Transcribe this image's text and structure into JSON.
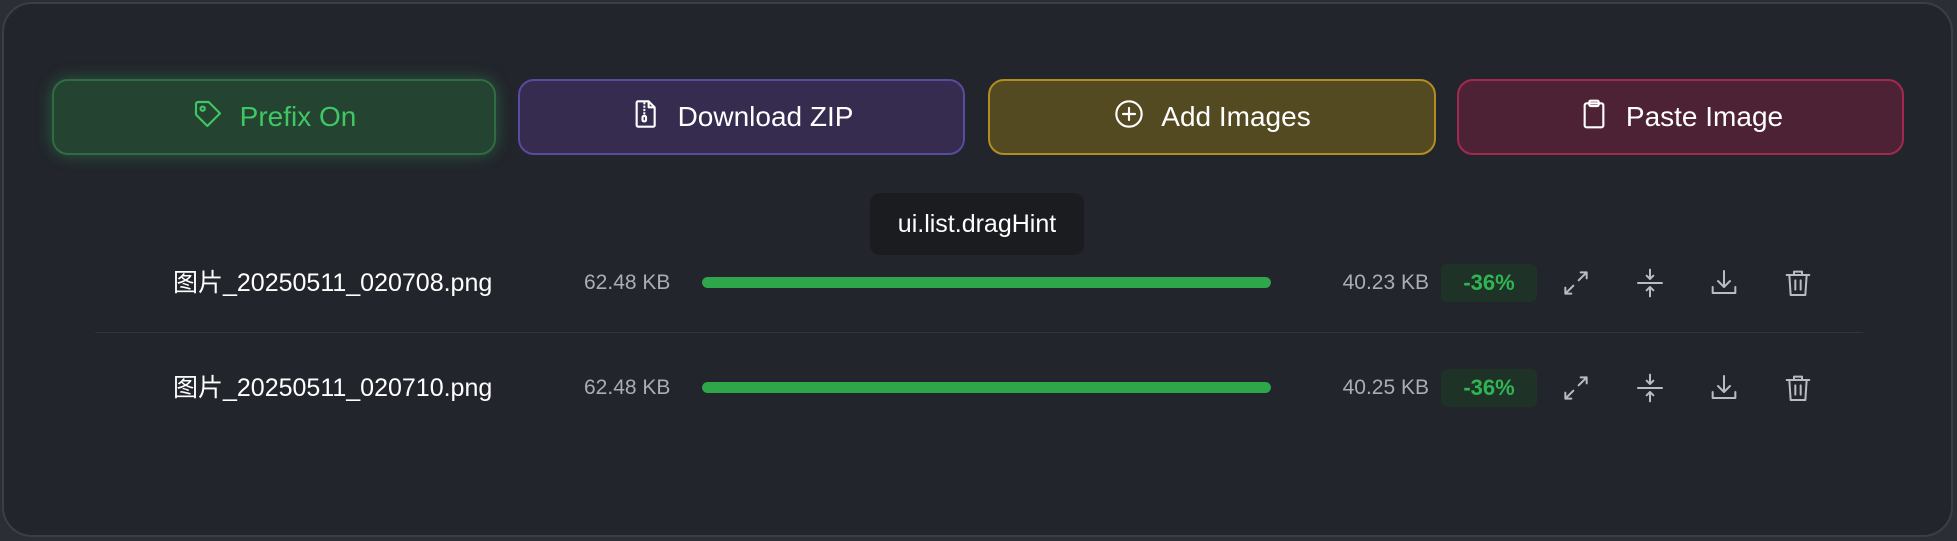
{
  "toolbar": {
    "prefix_label": "Prefix On",
    "download_label": "Download ZIP",
    "add_label": "Add Images",
    "paste_label": "Paste Image"
  },
  "tooltip": {
    "text": "ui.list.dragHint"
  },
  "files": [
    {
      "name": "图片_20250511_020708.png",
      "original_size": "62.48 KB",
      "progress": 1.0,
      "compressed_size": "40.23 KB",
      "savings": "-36%"
    },
    {
      "name": "图片_20250511_020710.png",
      "original_size": "62.48 KB",
      "progress": 1.0,
      "compressed_size": "40.25 KB",
      "savings": "-36%"
    }
  ],
  "colors": {
    "progress_fill": "#2ea74a",
    "prefix_accent": "#3ec764",
    "zip_border": "#5a4aa0",
    "add_border": "#b08e20",
    "paste_border": "#a4294f"
  },
  "icons": {
    "prefix": "tag-icon",
    "download_zip": "zip-file-icon",
    "add": "plus-circle-icon",
    "paste": "clipboard-icon",
    "row_actions": [
      "expand-icon",
      "compress-icon",
      "download-icon",
      "trash-icon"
    ]
  }
}
